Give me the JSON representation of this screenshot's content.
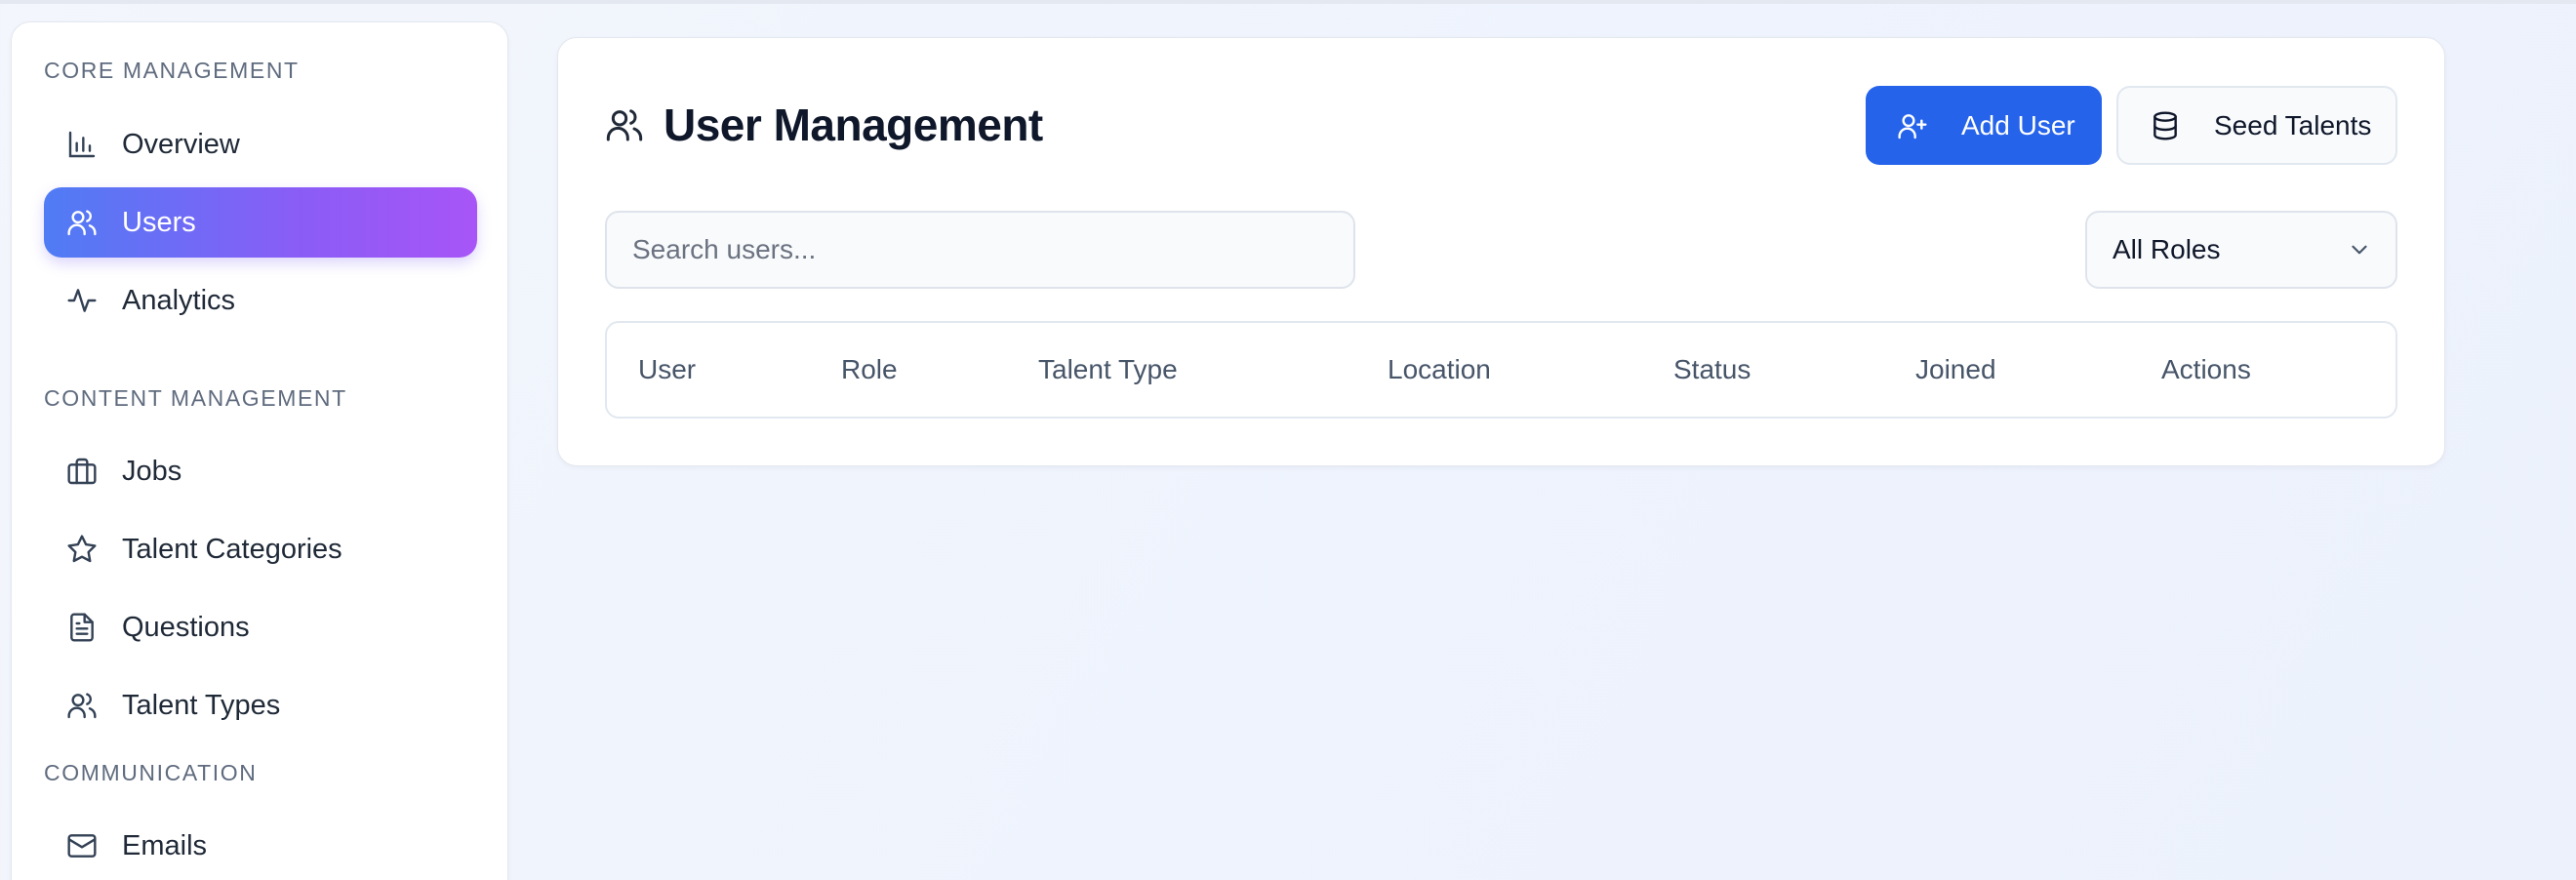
{
  "sidebar": {
    "sections": [
      {
        "label": "CORE MANAGEMENT"
      },
      {
        "label": "CONTENT MANAGEMENT"
      },
      {
        "label": "COMMUNICATION"
      }
    ],
    "items": [
      {
        "label": "Overview",
        "icon": "bar-chart-icon",
        "active": false
      },
      {
        "label": "Users",
        "icon": "users-icon",
        "active": true
      },
      {
        "label": "Analytics",
        "icon": "activity-icon",
        "active": false
      },
      {
        "label": "Jobs",
        "icon": "briefcase-icon",
        "active": false
      },
      {
        "label": "Talent Categories",
        "icon": "star-icon",
        "active": false
      },
      {
        "label": "Questions",
        "icon": "file-text-icon",
        "active": false
      },
      {
        "label": "Talent Types",
        "icon": "users-icon",
        "active": false
      },
      {
        "label": "Emails",
        "icon": "mail-icon",
        "active": false
      }
    ]
  },
  "main": {
    "title": "User Management",
    "title_icon": "users-icon",
    "buttons": {
      "add_user": "Add User",
      "seed_talents": "Seed Talents"
    },
    "search": {
      "placeholder": "Search users...",
      "value": ""
    },
    "role_filter": {
      "selected": "All Roles"
    },
    "table": {
      "columns": [
        "User",
        "Role",
        "Talent Type",
        "Location",
        "Status",
        "Joined",
        "Actions"
      ],
      "rows": []
    }
  },
  "colors": {
    "primary": "#2563eb",
    "active_gradient_start": "#4f7cf5",
    "active_gradient_end": "#a855f7"
  }
}
